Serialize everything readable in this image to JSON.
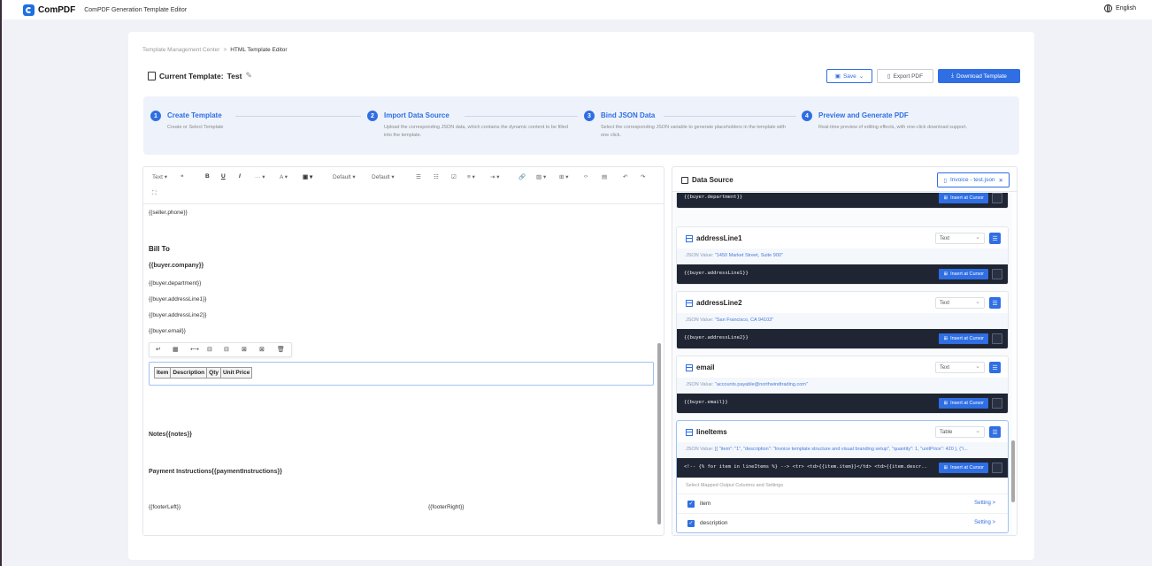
{
  "app": {
    "brand": "ComPDF",
    "title": "ComPDF Generation Template Editor",
    "language": "English"
  },
  "breadcrumb": {
    "parent": "Template Management Center",
    "sep": ">",
    "current": "HTML Template Editor"
  },
  "template": {
    "label": "Current Template:",
    "name": "Test"
  },
  "actions": {
    "save": "Save",
    "export": "Export PDF",
    "download": "Download Template"
  },
  "steps": [
    {
      "num": "1",
      "title": "Create Template",
      "desc": "Create or Select Template"
    },
    {
      "num": "2",
      "title": "Import Data Source",
      "desc": "Upload the corresponding JSON data, which contains the dynamic content to be filled into the template."
    },
    {
      "num": "3",
      "title": "Bind JSON Data",
      "desc": "Select the corresponding JSON variable to generate placeholders in the template with one click."
    },
    {
      "num": "4",
      "title": "Preview and Generate PDF",
      "desc": "Real-time preview of editing effects, with one-click download support."
    }
  ],
  "toolbar": {
    "text": "Text",
    "font1": "Default",
    "font2": "Default"
  },
  "doc": {
    "seller_phone": "{{seller.phone}}",
    "bill_to": "Bill To",
    "buyer_company": "{{buyer.company}}",
    "buyer_department": "{{buyer.department}}",
    "buyer_address1": "{{buyer.addressLine1}}",
    "buyer_address2": "{{buyer.addressLine2}}",
    "buyer_email": "{{buyer.email}}",
    "table_headers": [
      "Item",
      "Description",
      "Qty",
      "Unit Price"
    ],
    "notes": "Notes{{notes}}",
    "payment": "Payment Instructions{{paymentInstructions}}",
    "footer_left": "{{footerLeft}}",
    "footer_right": "{{footerRight}}"
  },
  "datasource": {
    "title": "Data Source",
    "file": "Invoice - test.json",
    "json_label": "JSON Value:",
    "insert_label": "Insert at Cursor",
    "department_code": "{{buyer.department}}",
    "fields": [
      {
        "name": "addressLine1",
        "type": "Text",
        "value": "\"1450 Market Street, Suite 900\"",
        "code": "{{buyer.addressLine1}}"
      },
      {
        "name": "addressLine2",
        "type": "Text",
        "value": "\"San Francisco, CA 94103\"",
        "code": "{{buyer.addressLine2}}"
      },
      {
        "name": "email",
        "type": "Text",
        "value": "\"accounts.payable@northwindtrading.com\"",
        "code": "{{buyer.email}}"
      },
      {
        "name": "lineItems",
        "type": "Table",
        "value": "[{ \"item\": \"1\", \"description\": \"Invoice template structure and visual branding setup\", \"quantity\": 1, \"unitPrice\": 420 }, {\"i...",
        "code": "<!-- {% for item in lineItems %} --> <tr> <td>{{item.item}}</td> <td>{{item.descr..."
      }
    ],
    "mapping_label": "Select Mapped Output Columns and Settings",
    "mapping_rows": [
      {
        "name": "item",
        "setting": "Setting >"
      },
      {
        "name": "description",
        "setting": "Setting >"
      }
    ]
  }
}
